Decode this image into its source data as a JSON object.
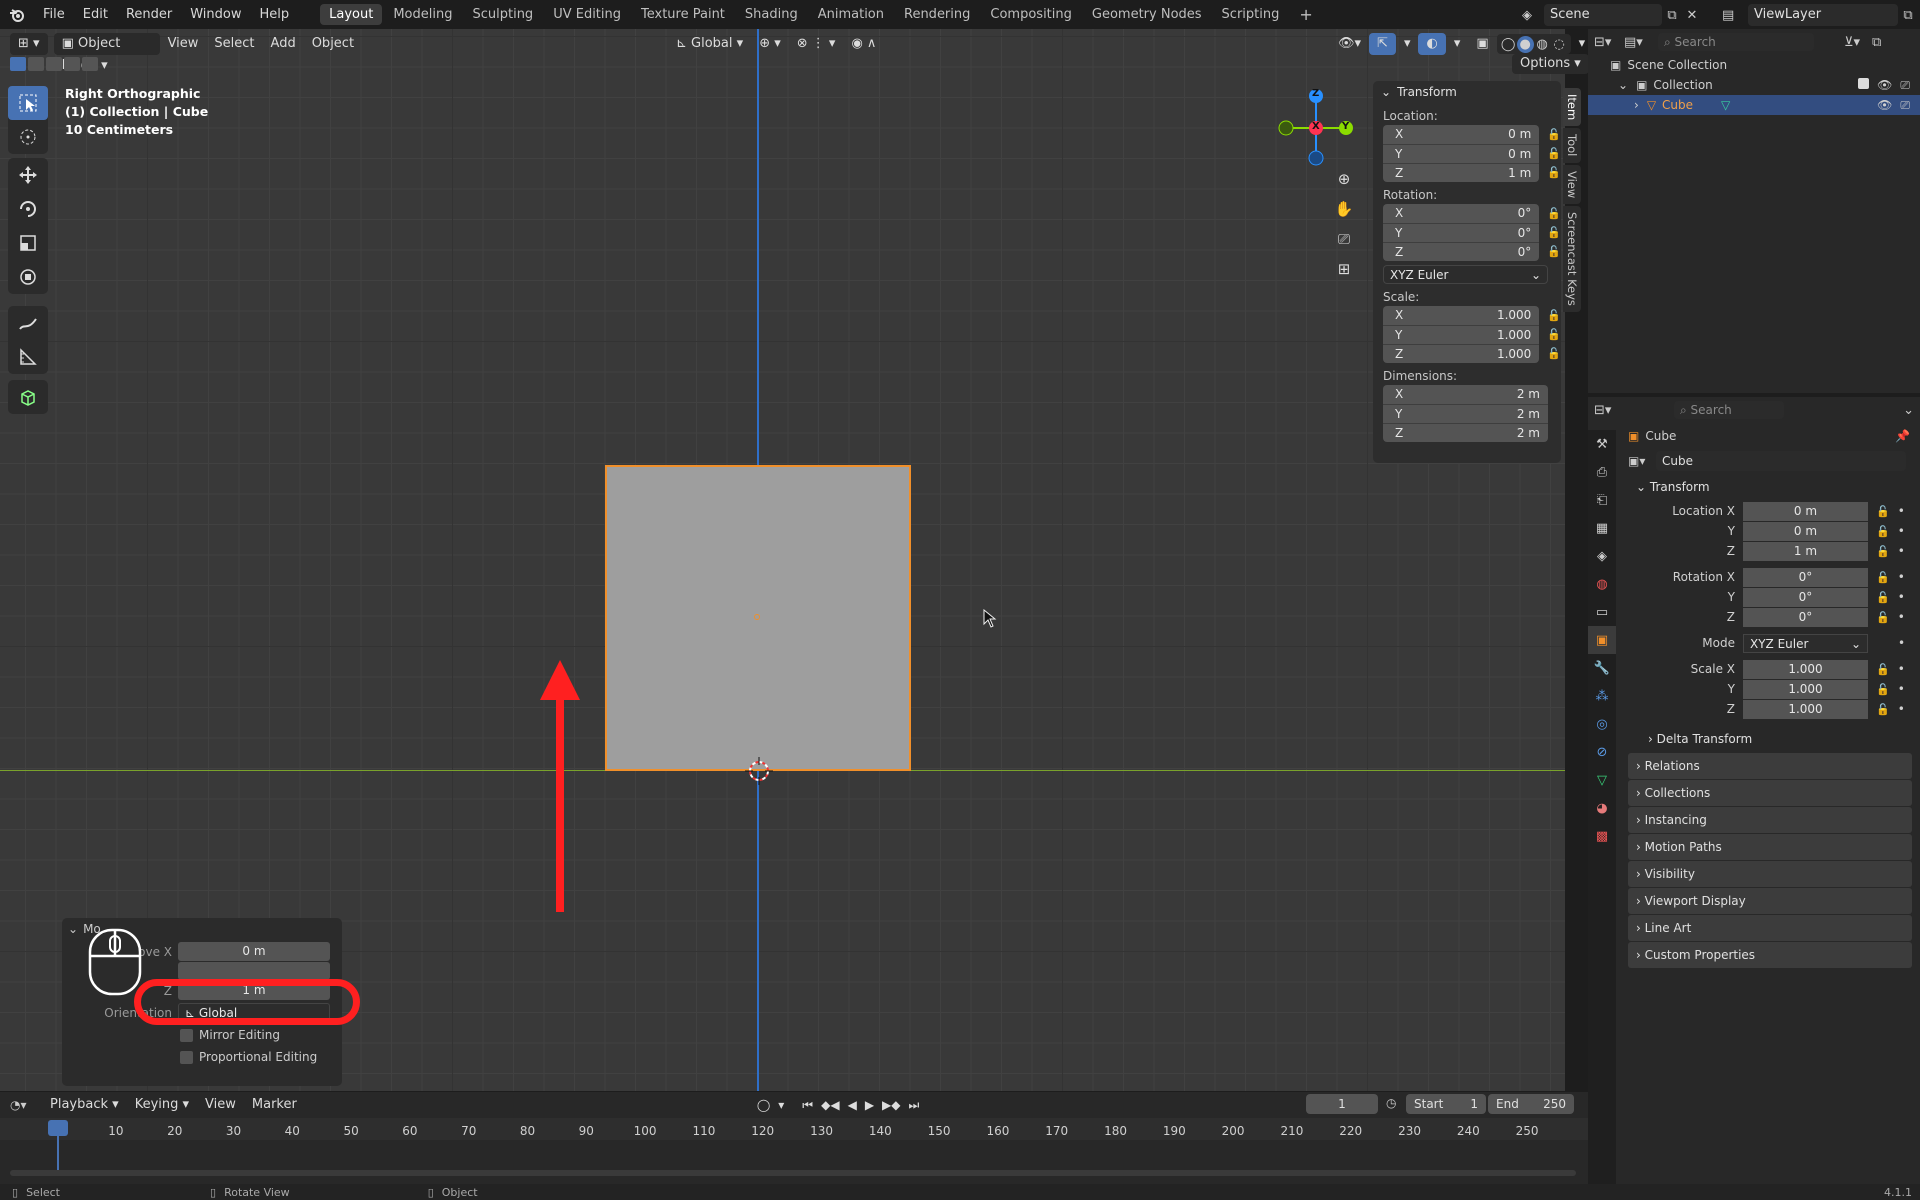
{
  "menu": [
    "File",
    "Edit",
    "Render",
    "Window",
    "Help"
  ],
  "workspaces": [
    "Layout",
    "Modeling",
    "Sculpting",
    "UV Editing",
    "Texture Paint",
    "Shading",
    "Animation",
    "Rendering",
    "Compositing",
    "Geometry Nodes",
    "Scripting"
  ],
  "active_workspace": "Layout",
  "scene": "Scene",
  "view_layer": "ViewLayer",
  "viewport_header": {
    "mode": "Object Mode",
    "menus": [
      "View",
      "Select",
      "Add",
      "Object"
    ],
    "orientation": "Global",
    "options": "Options"
  },
  "viewport_info": {
    "view_name": "Right Orthographic",
    "collection_object": "(1) Collection | Cube",
    "scale": "10 Centimeters"
  },
  "gizmo": {
    "z": "Z",
    "x": "X",
    "y": "Y"
  },
  "npanel": {
    "title": "Transform",
    "location_label": "Location:",
    "rotation_label": "Rotation:",
    "scale_label": "Scale:",
    "dimensions_label": "Dimensions:",
    "location": [
      {
        "axis": "X",
        "value": "0 m"
      },
      {
        "axis": "Y",
        "value": "0 m"
      },
      {
        "axis": "Z",
        "value": "1 m"
      }
    ],
    "rotation": [
      {
        "axis": "X",
        "value": "0°"
      },
      {
        "axis": "Y",
        "value": "0°"
      },
      {
        "axis": "Z",
        "value": "0°"
      }
    ],
    "rotation_mode": "XYZ Euler",
    "scale": [
      {
        "axis": "X",
        "value": "1.000"
      },
      {
        "axis": "Y",
        "value": "1.000"
      },
      {
        "axis": "Z",
        "value": "1.000"
      }
    ],
    "dimensions": [
      {
        "axis": "X",
        "value": "2 m"
      },
      {
        "axis": "Y",
        "value": "2 m"
      },
      {
        "axis": "Z",
        "value": "2 m"
      }
    ],
    "tabs": [
      "Item",
      "Tool",
      "View",
      "Screencast Keys"
    ]
  },
  "operator_panel": {
    "title": "Mo",
    "move_x_label": "Move X",
    "move_x": "0 m",
    "z_label": "Z",
    "z": "1 m",
    "orientation_label": "Orientation",
    "orientation": "Global",
    "mirror_editing": "Mirror Editing",
    "proportional_editing": "Proportional Editing"
  },
  "outliner": {
    "search_placeholder": "Search",
    "scene_collection": "Scene Collection",
    "collection": "Collection",
    "object": "Cube"
  },
  "properties": {
    "search_placeholder": "Search",
    "object_name": "Cube",
    "object_field": "Cube",
    "transform_title": "Transform",
    "location_x_label": "Location X",
    "y_label": "Y",
    "z_label": "Z",
    "rotation_x_label": "Rotation X",
    "mode_label": "Mode",
    "scale_x_label": "Scale X",
    "location": [
      "0 m",
      "0 m",
      "1 m"
    ],
    "rotation": [
      "0°",
      "0°",
      "0°"
    ],
    "mode": "XYZ Euler",
    "scale": [
      "1.000",
      "1.000",
      "1.000"
    ],
    "delta_transform": "Delta Transform",
    "sections": [
      "Relations",
      "Collections",
      "Instancing",
      "Motion Paths",
      "Visibility",
      "Viewport Display",
      "Line Art",
      "Custom Properties"
    ]
  },
  "timeline": {
    "menus": [
      "Playback",
      "Keying",
      "View",
      "Marker"
    ],
    "current_frame": "1",
    "start_label": "Start",
    "start": "1",
    "end_label": "End",
    "end": "250",
    "ticks": [
      "1",
      "10",
      "20",
      "30",
      "40",
      "50",
      "60",
      "70",
      "80",
      "90",
      "100",
      "110",
      "120",
      "130",
      "140",
      "150",
      "160",
      "170",
      "180",
      "190",
      "200",
      "210",
      "220",
      "230",
      "240",
      "250"
    ]
  },
  "statusbar": {
    "select": "Select",
    "rotate_view": "Rotate View",
    "object": "Object",
    "version": "4.1.1"
  },
  "colors": {
    "accent": "#4772b3",
    "selection_orange": "#f08f2a",
    "annotation_red": "#ff2020",
    "x_axis": "#ff3352",
    "y_axis": "#8bdc00",
    "z_axis": "#2890ff"
  }
}
